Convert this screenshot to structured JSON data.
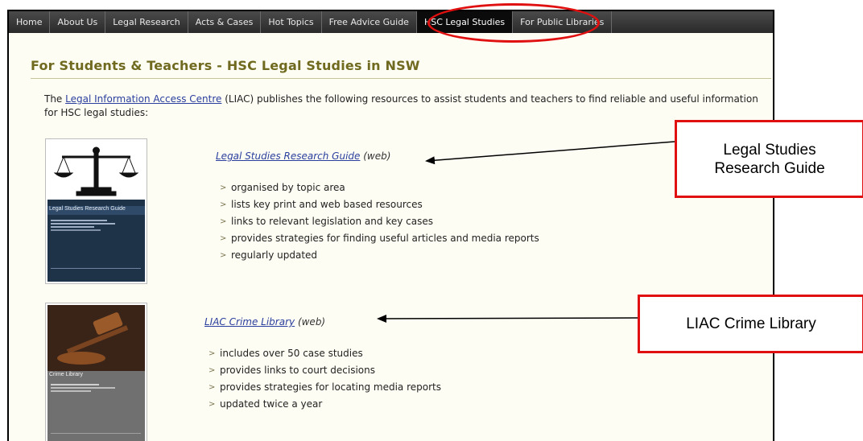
{
  "nav": {
    "items": [
      {
        "label": "Home"
      },
      {
        "label": "About Us"
      },
      {
        "label": "Legal Research"
      },
      {
        "label": "Acts & Cases"
      },
      {
        "label": "Hot Topics"
      },
      {
        "label": "Free Advice Guide"
      },
      {
        "label": "HSC Legal Studies",
        "active": true
      },
      {
        "label": "For Public Libraries"
      }
    ]
  },
  "page": {
    "title": "For Students & Teachers - HSC Legal Studies in NSW",
    "intro_before": "The ",
    "intro_link": "Legal Information Access Centre",
    "intro_after": " (LIAC) publishes the following resources to assist students and teachers to find reliable and useful information for HSC legal studies:"
  },
  "resources": [
    {
      "title": "Legal Studies Research Guide",
      "suffix": " (web)",
      "cover_title": "Legal Studies Research Guide",
      "cover_subtitle": "A guide to useful print and web-based resources for teachers and students of Legal Studies",
      "bullets": [
        "organised by topic area",
        "lists key print and web based resources",
        "links to relevant legislation and key cases",
        "provides strategies for finding useful articles and media reports",
        "regularly updated"
      ]
    },
    {
      "title": "LIAC Crime Library",
      "suffix": " (web)",
      "cover_title": "Crime Library",
      "cover_subtitle": "HSC Legal Studies",
      "bullets": [
        "includes over 50 case studies",
        "provides links to court decisions",
        "provides strategies for locating media reports",
        "updated twice a year"
      ]
    }
  ],
  "annotations": {
    "callout1": "Legal Studies Research Guide",
    "callout2": "LIAC Crime Library",
    "color": "#e01010"
  },
  "colors": {
    "nav_bg": "#333333",
    "title": "#6f6a1f",
    "link": "#2a3e9e",
    "page_bg": "#fefdf3"
  },
  "icons": [
    "chevron-right-icon",
    "scales-of-justice-icon",
    "gavel-icon"
  ]
}
